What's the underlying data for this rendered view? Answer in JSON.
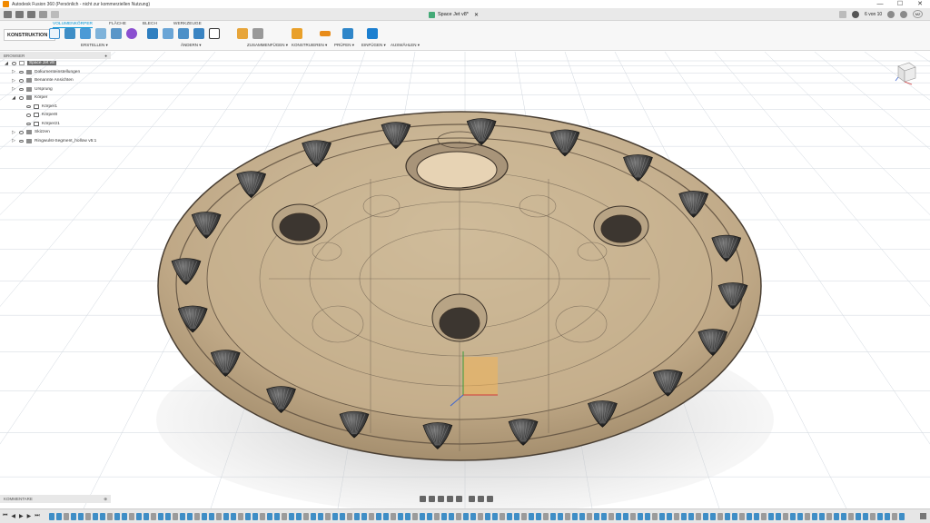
{
  "titlebar": {
    "title": "Autodesk Fusion 360 (Persönlich - nicht zur kommerziellen Nutzung)",
    "window_controls": [
      "—",
      "☐",
      "✕"
    ]
  },
  "document_tab": {
    "label": "Space Jet v8*",
    "jobs_label": "6 von 10",
    "user_initials": "MZ"
  },
  "workspace": {
    "label": "KONSTRUKTION ▾"
  },
  "toolbar": {
    "tabs": [
      "VOLUMENKÖRPER",
      "FLÄCHE",
      "BLECH",
      "WERKZEUGE"
    ],
    "groups": {
      "create": "ERSTELLEN ▾",
      "modify": "ÄNDERN ▾",
      "assemble": "ZUSAMMENFÜGEN ▾",
      "construct": "KONSTRUIEREN ▾",
      "inspect": "PRÜFEN ▾",
      "insert": "EINFÜGEN ▾",
      "select": "AUSWÄHLEN ▾"
    }
  },
  "browser": {
    "header": "BROWSER",
    "items": [
      {
        "label": "Space Jet v8",
        "level": 0,
        "arrow": "◢",
        "icon": "root"
      },
      {
        "label": "Dokumenteinstellungen",
        "level": 1,
        "arrow": "▷",
        "icon": "gear"
      },
      {
        "label": "Benannte Ansichten",
        "level": 1,
        "arrow": "▷",
        "icon": "folder"
      },
      {
        "label": "Ursprung",
        "level": 1,
        "arrow": "▷",
        "icon": "folder"
      },
      {
        "label": "Körper",
        "level": 1,
        "arrow": "◢",
        "icon": "folder"
      },
      {
        "label": "Körper1",
        "level": 2,
        "arrow": "",
        "icon": "body"
      },
      {
        "label": "Körper8",
        "level": 2,
        "arrow": "",
        "icon": "body"
      },
      {
        "label": "Körper21",
        "level": 2,
        "arrow": "",
        "icon": "body"
      },
      {
        "label": "Skizzen",
        "level": 1,
        "arrow": "▷",
        "icon": "folder"
      },
      {
        "label": "Ringwulst-Segment_hollow v5:1",
        "level": 1,
        "arrow": "▷",
        "icon": "component"
      }
    ]
  },
  "comments": {
    "label": "KOMMENTARE"
  },
  "timeline": {
    "controls": [
      "⏮",
      "◀",
      "▶",
      "▶",
      "⏭"
    ]
  },
  "colors": {
    "accent": "#0696d7",
    "body_fill": "#c4ad8b",
    "body_edge": "#5e5142",
    "thruster": "#2a2a2a",
    "grid": "#cfd6de"
  }
}
